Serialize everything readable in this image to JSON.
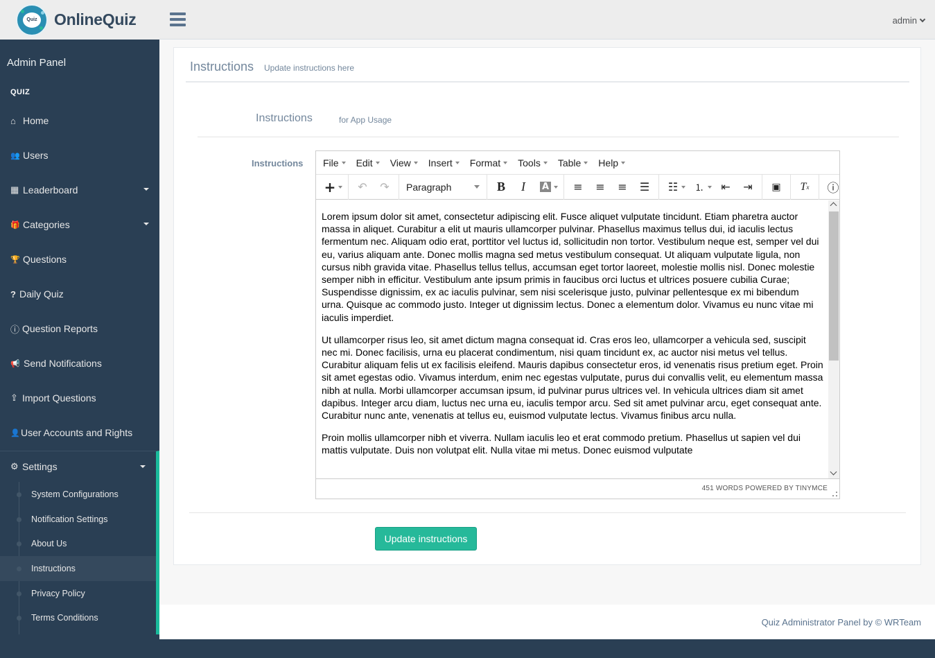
{
  "brand": {
    "name": "OnlineQuiz",
    "logo_text": "Quiz"
  },
  "sidebar": {
    "panel_title": "Admin Panel",
    "section_title": "QUIZ",
    "items": [
      {
        "label": "Home",
        "icon": "home-icon",
        "glyph": "⌂"
      },
      {
        "label": "Users",
        "icon": "users-icon",
        "glyph": "👥"
      },
      {
        "label": "Leaderboard",
        "icon": "grid-icon",
        "glyph": "▦"
      },
      {
        "label": "Categories",
        "icon": "gift-icon",
        "glyph": "🎁"
      },
      {
        "label": "Questions",
        "icon": "trophy-icon",
        "glyph": "🏆"
      },
      {
        "label": "Daily Quiz",
        "icon": "question-icon",
        "glyph": "?"
      },
      {
        "label": "Question Reports",
        "icon": "question-circle-icon",
        "glyph": "ⓘ"
      },
      {
        "label": "Send Notifications",
        "icon": "bullhorn-icon",
        "glyph": "📢"
      },
      {
        "label": "Import Questions",
        "icon": "upload-icon",
        "glyph": "⇪"
      },
      {
        "label": "User Accounts and Rights",
        "icon": "user-icon",
        "glyph": "👤"
      }
    ],
    "settings": {
      "label": "Settings",
      "icon": "gear-icon",
      "glyph": "⚙",
      "sub_items": [
        {
          "label": "System Configurations"
        },
        {
          "label": "Notification Settings"
        },
        {
          "label": "About Us"
        },
        {
          "label": "Instructions",
          "active": true
        },
        {
          "label": "Privacy Policy"
        },
        {
          "label": "Terms Conditions"
        }
      ]
    }
  },
  "topbar": {
    "user": "admin"
  },
  "page": {
    "title": "Instructions",
    "subtitle": "Update instructions here",
    "section_title": "Instructions",
    "section_subtitle": "for App Usage",
    "field_label": "Instructions",
    "submit_label": "Update instructions"
  },
  "editor": {
    "menus": [
      "File",
      "Edit",
      "View",
      "Insert",
      "Format",
      "Tools",
      "Table",
      "Help"
    ],
    "block_format": "Paragraph",
    "status": "451 WORDS POWERED BY TINYMCE",
    "paragraphs": [
      "Lorem ipsum dolor sit amet, consectetur adipiscing elit. Fusce aliquet vulputate tincidunt. Etiam pharetra auctor massa in aliquet. Curabitur a elit ut mauris ullamcorper pulvinar. Phasellus maximus tellus dui, id iaculis lectus fermentum nec. Aliquam odio erat, porttitor vel luctus id, sollicitudin non tortor. Vestibulum neque est, semper vel dui eu, varius aliquam ante. Donec mollis magna sed metus vestibulum consequat. Ut aliquam vulputate ligula, non cursus nibh gravida vitae. Phasellus tellus tellus, accumsan eget tortor laoreet, molestie mollis nisl. Donec molestie semper nibh in efficitur. Vestibulum ante ipsum primis in faucibus orci luctus et ultrices posuere cubilia Curae; Suspendisse dignissim, ex ac iaculis pulvinar, sem nisi scelerisque justo, pulvinar pellentesque ex mi bibendum urna. Quisque ac commodo justo. Integer ut dignissim lectus. Donec a elementum dolor. Vivamus eu nunc vitae mi iaculis imperdiet.",
      "Ut ullamcorper risus leo, sit amet dictum magna consequat id. Cras eros leo, ullamcorper a vehicula sed, suscipit nec mi. Donec facilisis, urna eu placerat condimentum, nisi quam tincidunt ex, ac auctor nisi metus vel tellus. Curabitur aliquam felis ut ex facilisis eleifend. Mauris dapibus consectetur eros, id venenatis risus pretium eget. Proin sit amet egestas odio. Vivamus interdum, enim nec egestas vulputate, purus dui convallis velit, eu elementum massa nibh at nulla. Morbi ullamcorper accumsan ipsum, id pulvinar purus ultrices vel. In vehicula ultrices diam sit amet dapibus. Integer arcu diam, luctus nec urna eu, iaculis tempor arcu. Sed sit amet pulvinar arcu, eget consequat ante. Curabitur nunc ante, venenatis at tellus eu, euismod vulputate lectus. Vivamus finibus arcu nulla.",
      "Proin mollis ullamcorper nibh et viverra. Nullam iaculis leo et erat commodo pretium. Phasellus ut sapien vel dui mattis vulputate. Duis non volutpat elit. Nulla vitae mi metus. Donec euismod vulputate"
    ]
  },
  "footer": {
    "text": "Quiz Administrator Panel by ",
    "link": "© WRTeam"
  },
  "colors": {
    "sidebar": "#2a3f54",
    "accent": "#26b99a",
    "topbar": "#ededed"
  }
}
